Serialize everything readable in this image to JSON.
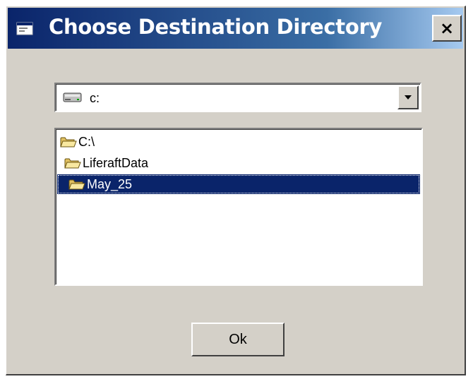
{
  "window": {
    "title": "Choose Destination Directory",
    "title_icon": "app-window-icon",
    "close_label": "×",
    "close_icon": "close-icon",
    "titlebar_color": "#0a246a",
    "face_color": "#d4d0c8"
  },
  "drive": {
    "selected_value": "c:",
    "icon": "hard-drive-icon",
    "dropdown_icon": "triangle-down-icon"
  },
  "directories": [
    {
      "label": "C:\\",
      "icon": "open-folder-icon",
      "selected": false
    },
    {
      "label": "LiferaftData",
      "icon": "open-folder-icon",
      "selected": false
    },
    {
      "label": "May_25",
      "icon": "open-folder-icon",
      "selected": true
    }
  ],
  "selection_color": "#0a246a",
  "ok_button": {
    "label": "Ok"
  }
}
